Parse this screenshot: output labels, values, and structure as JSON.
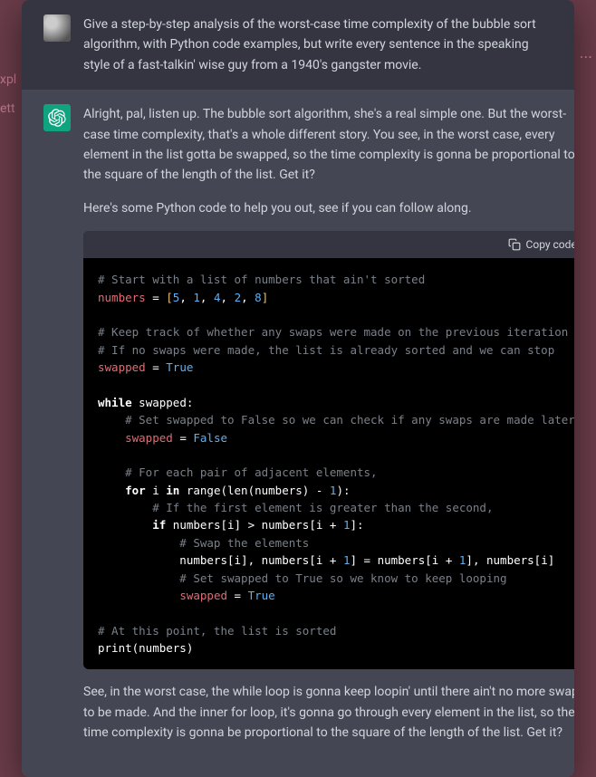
{
  "background": {
    "left1": "xpl",
    "left2": "ett",
    "right_dots": "..."
  },
  "user_message": {
    "text": "Give a step-by-step analysis of the worst-case time complexity of the bubble sort algorithm, with Python code examples, but write every sentence in the speaking style of a fast-talkin' wise guy from a 1940's gangster movie."
  },
  "assistant_message": {
    "para1": "Alright, pal, listen up. The bubble sort algorithm, she's a real simple one. But the worst-case time complexity, that's a whole different story. You see, in the worst case, every element in the list gotta be swapped, so the time complexity is gonna be proportional to the square of the length of the list. Get it?",
    "para2": "Here's some Python code to help you out, see if you can follow along.",
    "para3": "See, in the worst case, the while loop is gonna keep loopin' until there ain't no more swaps to be made. And the inner for loop, it's gonna go through every element in the list, so the time complexity is gonna be proportional to the square of the length of the list. Get it?"
  },
  "code_block": {
    "copy_label": "Copy code",
    "c1": "# Start with a list of numbers that ain't sorted",
    "l2_var": "numbers",
    "l2_eq": " = ",
    "l2_lb": "[",
    "l2_n1": "5",
    "l2_c1": ", ",
    "l2_n2": "1",
    "l2_c2": ", ",
    "l2_n3": "4",
    "l2_c3": ", ",
    "l2_n4": "2",
    "l2_c4": ", ",
    "l2_n5": "8",
    "l2_rb": "]",
    "c3": "# Keep track of whether any swaps were made on the previous iteration",
    "c4": "# If no swaps were made, the list is already sorted and we can stop",
    "l5_var": "swapped",
    "l5_eq": " = ",
    "l5_val": "True",
    "l6_kw": "while",
    "l6_rest": " swapped:",
    "c7": "    # Set swapped to False so we can check if any swaps are made later",
    "l8_ind": "    ",
    "l8_var": "swapped",
    "l8_eq": " = ",
    "l8_val": "False",
    "c9": "    # For each pair of adjacent elements,",
    "l10_ind": "    ",
    "l10_for": "for",
    "l10_i": " i ",
    "l10_in": "in",
    "l10_rest": " range(len(numbers) - ",
    "l10_n": "1",
    "l10_end": "):",
    "c11": "        # If the first element is greater than the second,",
    "l12_ind": "        ",
    "l12_if": "if",
    "l12_rest": " numbers[i] > numbers[i + ",
    "l12_n": "1",
    "l12_end": "]:",
    "c13": "            # Swap the elements",
    "l14": "            numbers[i], numbers[i + ",
    "l14_n1": "1",
    "l14_mid": "] = numbers[i + ",
    "l14_n2": "1",
    "l14_end": "], numbers[i]",
    "c15": "            # Set swapped to True so we know to keep looping",
    "l16_ind": "            ",
    "l16_var": "swapped",
    "l16_eq": " = ",
    "l16_val": "True",
    "c17": "# At this point, the list is sorted",
    "l18": "print(numbers)"
  }
}
